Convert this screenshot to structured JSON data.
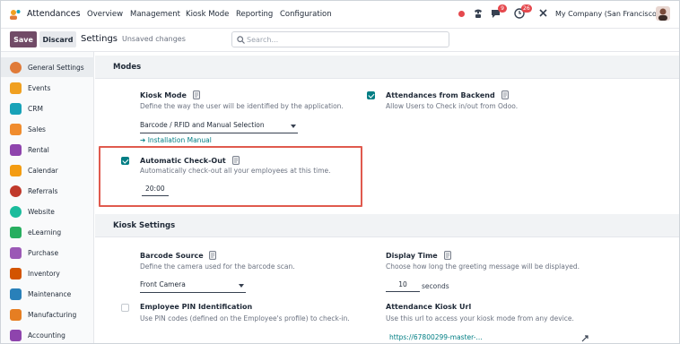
{
  "navbar": {
    "app_title": "Attendances",
    "menu": [
      "Overview",
      "Management",
      "Kiosk Mode",
      "Reporting",
      "Configuration"
    ],
    "chat_badge": "9",
    "activity_badge": "26",
    "company": "My Company (San Francisco)"
  },
  "control_panel": {
    "save_label": "Save",
    "discard_label": "Discard",
    "title": "Settings",
    "unsaved": "Unsaved changes",
    "search_placeholder": "Search..."
  },
  "sidebar": {
    "items": [
      {
        "label": "General Settings",
        "color": "#e07b39"
      },
      {
        "label": "Events",
        "color": "#f0a020"
      },
      {
        "label": "CRM",
        "color": "#17a2b8"
      },
      {
        "label": "Sales",
        "color": "#f08c2e"
      },
      {
        "label": "Rental",
        "color": "#8e44ad"
      },
      {
        "label": "Calendar",
        "color": "#f39c12"
      },
      {
        "label": "Referrals",
        "color": "#c0392b"
      },
      {
        "label": "Website",
        "color": "#1abc9c"
      },
      {
        "label": "eLearning",
        "color": "#27ae60"
      },
      {
        "label": "Purchase",
        "color": "#9b59b6"
      },
      {
        "label": "Inventory",
        "color": "#d35400"
      },
      {
        "label": "Maintenance",
        "color": "#2980b9"
      },
      {
        "label": "Manufacturing",
        "color": "#e67e22"
      },
      {
        "label": "Accounting",
        "color": "#8e44ad"
      }
    ]
  },
  "modes": {
    "section_title": "Modes",
    "kiosk_mode": {
      "title": "Kiosk Mode",
      "desc": "Define the way the user will be identified by the application.",
      "value": "Barcode / RFID and Manual Selection",
      "link": "Installation Manual"
    },
    "backend": {
      "title": "Attendances from Backend",
      "desc": "Allow Users to Check in/out from Odoo."
    },
    "auto_checkout": {
      "title": "Automatic Check-Out",
      "desc": "Automatically check-out all your employees at this time.",
      "time": "20:00"
    }
  },
  "kiosk_settings": {
    "section_title": "Kiosk Settings",
    "barcode_source": {
      "title": "Barcode Source",
      "desc": "Define the camera used for the barcode scan.",
      "value": "Front Camera"
    },
    "display_time": {
      "title": "Display Time",
      "desc": "Choose how long the greeting message will be displayed.",
      "value": "10",
      "unit": "seconds"
    },
    "pin": {
      "title": "Employee PIN Identification",
      "desc": "Use PIN codes (defined on the Employee's profile) to check-in."
    },
    "kiosk_url": {
      "title": "Attendance Kiosk Url",
      "desc": "Use this url to access your kiosk mode from any device.",
      "value": "https://67800299-master-..."
    }
  },
  "colors": {
    "brand": "#714b67",
    "accent": "#017e84",
    "highlight": "#e05a4e"
  }
}
